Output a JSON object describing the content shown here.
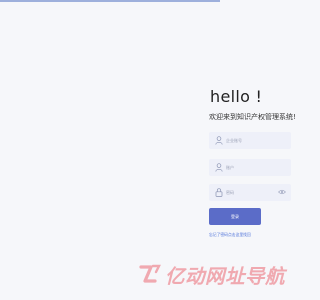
{
  "login": {
    "greeting": "hello !",
    "welcome": "欢迎来到知识产权管理系统!",
    "username_placeholder": "企业账号",
    "password_label_placeholder": "账户",
    "password_placeholder": "密码",
    "submit_label": "登录",
    "forgot_link": "忘记了密码点击这里找回"
  },
  "watermark": {
    "text": "亿动网址导航"
  },
  "colors": {
    "page_bg": "#f6f7fa",
    "field_bg": "#eef0f9",
    "button_bg": "#5b6cc8",
    "link": "#4a6fd8",
    "watermark": "#f0a9b0"
  },
  "icons": [
    "user-icon",
    "account-icon",
    "lock-icon",
    "eye-icon"
  ]
}
